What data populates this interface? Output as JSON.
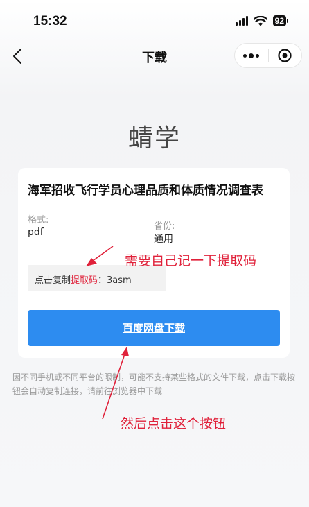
{
  "status_bar": {
    "time": "15:32",
    "battery": "92"
  },
  "nav": {
    "title": "下载"
  },
  "brand": "蜻学",
  "card": {
    "title": "海军招收飞行学员心理品质和体质情况调查表",
    "format_label": "格式:",
    "format_value": "pdf",
    "province_label": "省份:",
    "province_value": "通用",
    "code_prefix": "点击复制",
    "code_highlight": "提取码",
    "code_suffix": "：3asm",
    "download_label": "百度网盘下载"
  },
  "notice": "因不同手机或不同平台的限制，可能不支持某些格式的文件下载，点击下载按钮会自动复制连接，请前往浏览器中下载",
  "annotations": {
    "note1": "需要自己记一下提取码",
    "note2": "然后点击这个按钮",
    "color": "#e0213a"
  },
  "accent_color": "#2d8cf0"
}
